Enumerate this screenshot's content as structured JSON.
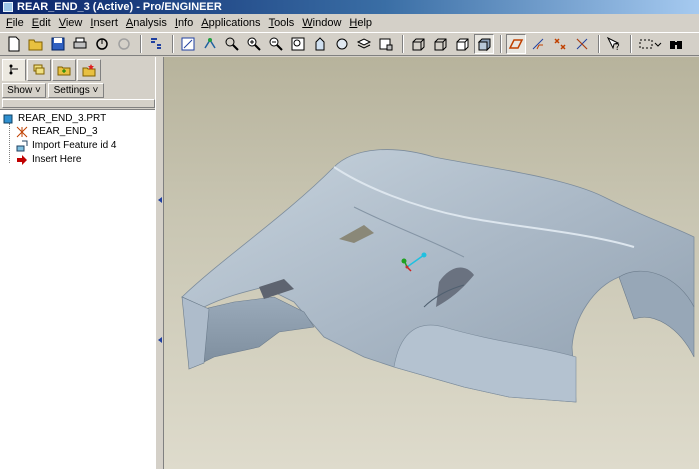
{
  "window": {
    "title": "REAR_END_3 (Active) - Pro/ENGINEER"
  },
  "menu": [
    {
      "u": "F",
      "rest": "ile"
    },
    {
      "u": "E",
      "rest": "dit"
    },
    {
      "u": "V",
      "rest": "iew"
    },
    {
      "u": "I",
      "rest": "nsert"
    },
    {
      "u": "A",
      "rest": "nalysis"
    },
    {
      "u": "I",
      "rest": "nfo"
    },
    {
      "u": "A",
      "rest": "pplications"
    },
    {
      "u": "T",
      "rest": "ools"
    },
    {
      "u": "W",
      "rest": "indow"
    },
    {
      "u": "H",
      "rest": "elp"
    }
  ],
  "toolbar": {
    "icons": [
      "new-file-icon",
      "open-folder-icon",
      "save-icon",
      "print-icon",
      "send-mail-icon",
      "erase-icon",
      "regenerate-icon",
      "repaint-icon",
      "spin-center-icon",
      "orient-icon",
      "zoom-in-icon",
      "zoom-out-icon",
      "refit-icon",
      "named-views-icon",
      "layers-icon",
      "model-display-icon",
      "wireframe-icon",
      "hidden-line-icon",
      "no-hidden-icon",
      "shading-icon",
      "datum-planes-icon",
      "datum-axes-icon",
      "datum-points-icon",
      "coordinate-systems-icon",
      "whats-this-icon",
      "selection-filter-icon",
      "binoculars-icon"
    ]
  },
  "panel": {
    "tabs": [
      "model-tree-icon",
      "layer-tree-icon",
      "folder-browser-icon",
      "favorites-icon"
    ],
    "show_label": "Show",
    "settings_label": "Settings"
  },
  "tree": {
    "root": "REAR_END_3.PRT",
    "items": [
      {
        "label": "REAR_END_3",
        "icon": "csys-icon"
      },
      {
        "label": "Import Feature id 4",
        "icon": "import-feature-icon"
      },
      {
        "label": "Insert Here",
        "icon": "insert-arrow-icon"
      }
    ]
  },
  "colors": {
    "title_gradient_start": "#0a246a",
    "viewport_top": "#b7b39c",
    "part_surface": "#aab8c6",
    "insert_arrow": "#c00000"
  }
}
